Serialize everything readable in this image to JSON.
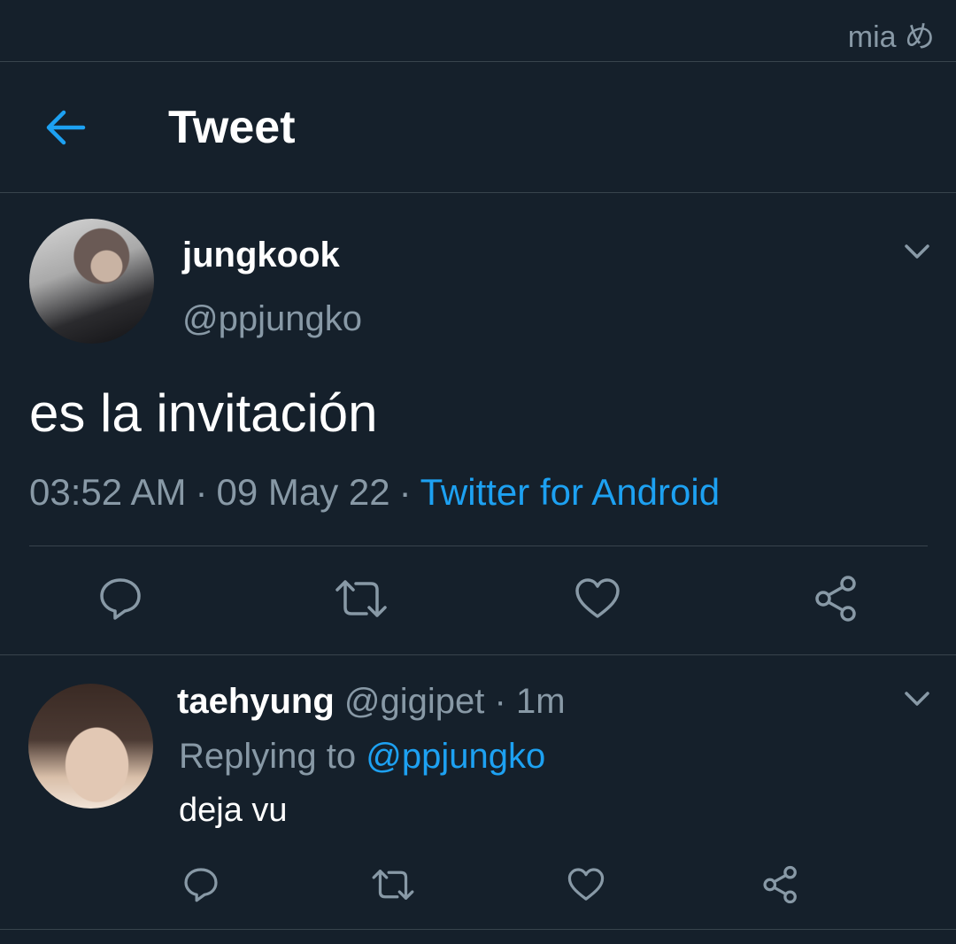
{
  "status_bar": {
    "text": "mia め"
  },
  "header": {
    "title": "Tweet",
    "back_icon": "arrow-left-icon"
  },
  "tweet": {
    "name": "jungkook",
    "handle": "@ppjungko",
    "text": "es la invitación",
    "time": "03:52 AM",
    "date": "09 May 22",
    "separator": "·",
    "source": "Twitter for Android"
  },
  "actions": [
    "reply-icon",
    "retweet-icon",
    "like-icon",
    "share-icon"
  ],
  "reply": {
    "name": "taehyung",
    "handle": "@gigipet",
    "dot": "·",
    "time": "1m",
    "replying_label": "Replying to",
    "replying_handle": "@ppjungko",
    "text": "deja vu"
  },
  "colors": {
    "background": "#15202b",
    "accent": "#1da1f2",
    "muted": "#8899a6",
    "divider": "#38444d"
  }
}
